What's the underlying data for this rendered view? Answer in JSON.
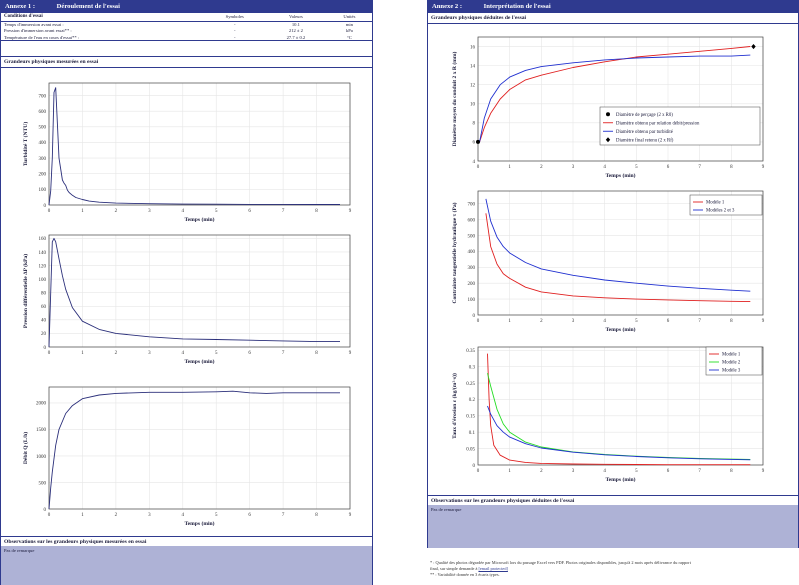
{
  "left": {
    "annex_num": "Annexe 1 :",
    "annex_title": "Déroulement de l'essai",
    "conditions": {
      "headers": [
        "Conditions d'essai",
        "Symboles",
        "Valeurs",
        "Unités"
      ],
      "rows": [
        [
          "Temps d'immersion avant essai :",
          "-",
          "10.1",
          "min"
        ],
        [
          "Pression d'immersion avant essai** :",
          "-",
          "212 ± 2",
          "kPa"
        ],
        [
          "Température de l'eau en cours d'essai** :",
          "-",
          "27.7 ± 0.2",
          "°C"
        ]
      ]
    },
    "measured_title": "Grandeurs physiques mesurées en essai",
    "observations_title": "Observations sur les grandeurs physiques mesurées en essai",
    "observations_text": "Pas de remarque"
  },
  "right": {
    "annex_num": "Annexe 2 :",
    "annex_title": "Interprétation de l'essai",
    "deduced_title": "Grandeurs physiques déduites de l'essai",
    "observations_title": "Observations sur les grandeurs physiques déduites de l'essai",
    "observations_text": "Pas de remarque"
  },
  "footnotes": {
    "line1": "* : Qualité des photos dégradée par Microsoft lors du passage Excel vers PDF. Photos originales disponibles, jusqu'à 2 mois après délivrance du rapport",
    "line2_prefix": "final, sur simple demande à ",
    "line2_link": "[email protected]",
    "line3": "** : Variabilité donnée en 3 écarts types."
  },
  "colors": {
    "primary": "#2f3a8f",
    "obs_fill": "#aeb2d6",
    "red": "#e02020",
    "green": "#22dd22",
    "blue": "#2030d0"
  },
  "chart_data": [
    {
      "type": "line",
      "xlabel": "Temps (min)",
      "ylabel": "Turbidité T (NTU)",
      "xlim": [
        0,
        9
      ],
      "ylim": [
        0,
        780
      ],
      "xticks": [
        0,
        1,
        2,
        3,
        4,
        5,
        6,
        7,
        8,
        9
      ],
      "yticks": [
        0,
        100,
        200,
        300,
        400,
        500,
        600,
        700
      ],
      "series": [
        {
          "color": "#2b2f7a",
          "x": [
            0,
            0.05,
            0.1,
            0.15,
            0.2,
            0.25,
            0.3,
            0.35,
            0.4,
            0.45,
            0.5,
            0.55,
            0.6,
            0.7,
            0.8,
            1.0,
            1.2,
            1.5,
            2,
            3,
            4,
            5,
            6,
            7,
            8,
            8.7
          ],
          "y": [
            0,
            90,
            300,
            720,
            750,
            520,
            300,
            230,
            160,
            140,
            125,
            95,
            80,
            62,
            48,
            35,
            25,
            18,
            12,
            8,
            6,
            5,
            4,
            4,
            3,
            3
          ]
        }
      ]
    },
    {
      "type": "line",
      "xlabel": "Temps (min)",
      "ylabel": "Pression différentielle ΔP (kPa)",
      "xlim": [
        0,
        9
      ],
      "ylim": [
        0,
        165
      ],
      "xticks": [
        0,
        1,
        2,
        3,
        4,
        5,
        6,
        7,
        8,
        9
      ],
      "yticks": [
        0,
        20,
        40,
        60,
        80,
        100,
        120,
        140,
        160
      ],
      "series": [
        {
          "color": "#2b2f7a",
          "x": [
            0,
            0.1,
            0.15,
            0.2,
            0.3,
            0.4,
            0.5,
            0.7,
            1.0,
            1.5,
            2,
            3,
            4,
            5,
            6,
            7,
            8,
            8.7
          ],
          "y": [
            0,
            155,
            160,
            155,
            130,
            105,
            85,
            58,
            38,
            26,
            20,
            15,
            12,
            11,
            10,
            9,
            8,
            8
          ]
        }
      ]
    },
    {
      "type": "line",
      "xlabel": "Temps (min)",
      "ylabel": "Débit Q (L/h)",
      "xlim": [
        0,
        9
      ],
      "ylim": [
        0,
        2300
      ],
      "xticks": [
        0,
        1,
        2,
        3,
        4,
        5,
        6,
        7,
        8,
        9
      ],
      "yticks": [
        0,
        500,
        1000,
        1500,
        2000
      ],
      "series": [
        {
          "color": "#2b2f7a",
          "x": [
            0,
            0.05,
            0.1,
            0.2,
            0.3,
            0.5,
            0.7,
            1.0,
            1.5,
            2,
            3,
            4,
            5,
            5.5,
            6,
            6.5,
            7,
            8,
            8.7
          ],
          "y": [
            0,
            400,
            700,
            1200,
            1500,
            1800,
            1950,
            2080,
            2150,
            2180,
            2200,
            2200,
            2210,
            2220,
            2190,
            2180,
            2190,
            2190,
            2190
          ]
        }
      ]
    },
    {
      "type": "line",
      "xlabel": "Temps (min)",
      "ylabel": "Diamètre moyen du conduit 2 x R (mm)",
      "xlim": [
        0,
        9
      ],
      "ylim": [
        4,
        17
      ],
      "xticks": [
        0,
        1,
        2,
        3,
        4,
        5,
        6,
        7,
        8,
        9
      ],
      "yticks": [
        4,
        6,
        8,
        10,
        12,
        14,
        16
      ],
      "legend": [
        "Diamètre de perçage (2 x R0)",
        "Diamètre obtenu par relation débit/pression",
        "Diamètre obtenu par turbidité",
        "Diamètre final retenu (2 x Rf)"
      ],
      "series": [
        {
          "name": "Diamètre obtenu par relation débit/pression",
          "color": "#e02020",
          "x": [
            0.05,
            0.2,
            0.4,
            0.7,
            1,
            1.5,
            2,
            3,
            4,
            5,
            6,
            7,
            8,
            8.6
          ],
          "y": [
            6.0,
            7.5,
            9.0,
            10.5,
            11.5,
            12.5,
            13.0,
            13.8,
            14.4,
            14.9,
            15.2,
            15.5,
            15.8,
            16.0
          ]
        },
        {
          "name": "Diamètre obtenu par turbidité",
          "color": "#2030d0",
          "x": [
            0.05,
            0.2,
            0.4,
            0.7,
            1,
            1.5,
            2,
            3,
            4,
            5,
            6,
            7,
            8,
            8.6
          ],
          "y": [
            6.0,
            8.5,
            10.5,
            12.0,
            12.8,
            13.5,
            13.9,
            14.3,
            14.6,
            14.8,
            14.9,
            15.0,
            15.0,
            15.1
          ]
        }
      ],
      "points": [
        {
          "name": "Diamètre de perçage (2 x R0)",
          "x": 0,
          "y": 6,
          "marker": "circle"
        },
        {
          "name": "Diamètre final retenu (2 x Rf)",
          "x": 8.7,
          "y": 16,
          "marker": "diamond"
        }
      ]
    },
    {
      "type": "line",
      "xlabel": "Temps (min)",
      "ylabel": "Contrainte tangentielle hydraulique τ (Pa)",
      "xlim": [
        0,
        9
      ],
      "ylim": [
        0,
        780
      ],
      "xticks": [
        0,
        1,
        2,
        3,
        4,
        5,
        6,
        7,
        8,
        9
      ],
      "yticks": [
        0,
        100,
        200,
        300,
        400,
        500,
        600,
        700
      ],
      "legend": [
        "Modèle 1",
        "Modèles 2 et 3"
      ],
      "series": [
        {
          "name": "Modèle 1",
          "color": "#e02020",
          "x": [
            0.25,
            0.4,
            0.6,
            0.8,
            1,
            1.5,
            2,
            3,
            4,
            5,
            6,
            7,
            8,
            8.6
          ],
          "y": [
            640,
            430,
            320,
            260,
            230,
            175,
            145,
            120,
            108,
            100,
            95,
            90,
            86,
            84
          ]
        },
        {
          "name": "Modèles 2 et 3",
          "color": "#2030d0",
          "x": [
            0.25,
            0.4,
            0.6,
            0.8,
            1,
            1.5,
            2,
            3,
            4,
            5,
            6,
            7,
            8,
            8.6
          ],
          "y": [
            730,
            590,
            490,
            430,
            390,
            330,
            290,
            250,
            220,
            200,
            182,
            168,
            156,
            150
          ]
        }
      ]
    },
    {
      "type": "line",
      "xlabel": "Temps (min)",
      "ylabel": "Taux d'érosion ε (kg/(m²·s))",
      "xlim": [
        0,
        9
      ],
      "ylim": [
        0,
        0.36
      ],
      "xticks": [
        0,
        1,
        2,
        3,
        4,
        5,
        6,
        7,
        8,
        9
      ],
      "yticks": [
        0,
        0.05,
        0.1,
        0.15,
        0.2,
        0.25,
        0.3,
        0.35
      ],
      "legend": [
        "Modèle 1",
        "Modèle 2",
        "Modèle 3"
      ],
      "series": [
        {
          "name": "Modèle 1",
          "color": "#e02020",
          "x": [
            0.3,
            0.35,
            0.4,
            0.5,
            0.7,
            1,
            1.5,
            2,
            3,
            4,
            6,
            8,
            8.6
          ],
          "y": [
            0.34,
            0.2,
            0.12,
            0.06,
            0.03,
            0.015,
            0.008,
            0.005,
            0.003,
            0.002,
            0.001,
            0.001,
            0.001
          ]
        },
        {
          "name": "Modèle 2",
          "color": "#22dd22",
          "x": [
            0.3,
            0.4,
            0.6,
            0.8,
            1,
            1.5,
            2,
            3,
            4,
            5,
            6,
            7,
            8,
            8.6
          ],
          "y": [
            0.28,
            0.24,
            0.17,
            0.125,
            0.1,
            0.07,
            0.055,
            0.04,
            0.032,
            0.027,
            0.023,
            0.02,
            0.018,
            0.017
          ]
        },
        {
          "name": "Modèle 3",
          "color": "#2030d0",
          "x": [
            0.3,
            0.4,
            0.6,
            0.8,
            1,
            1.5,
            2,
            3,
            4,
            5,
            6,
            7,
            8,
            8.6
          ],
          "y": [
            0.18,
            0.155,
            0.12,
            0.1,
            0.085,
            0.065,
            0.052,
            0.039,
            0.031,
            0.026,
            0.022,
            0.019,
            0.017,
            0.016
          ]
        }
      ]
    }
  ]
}
